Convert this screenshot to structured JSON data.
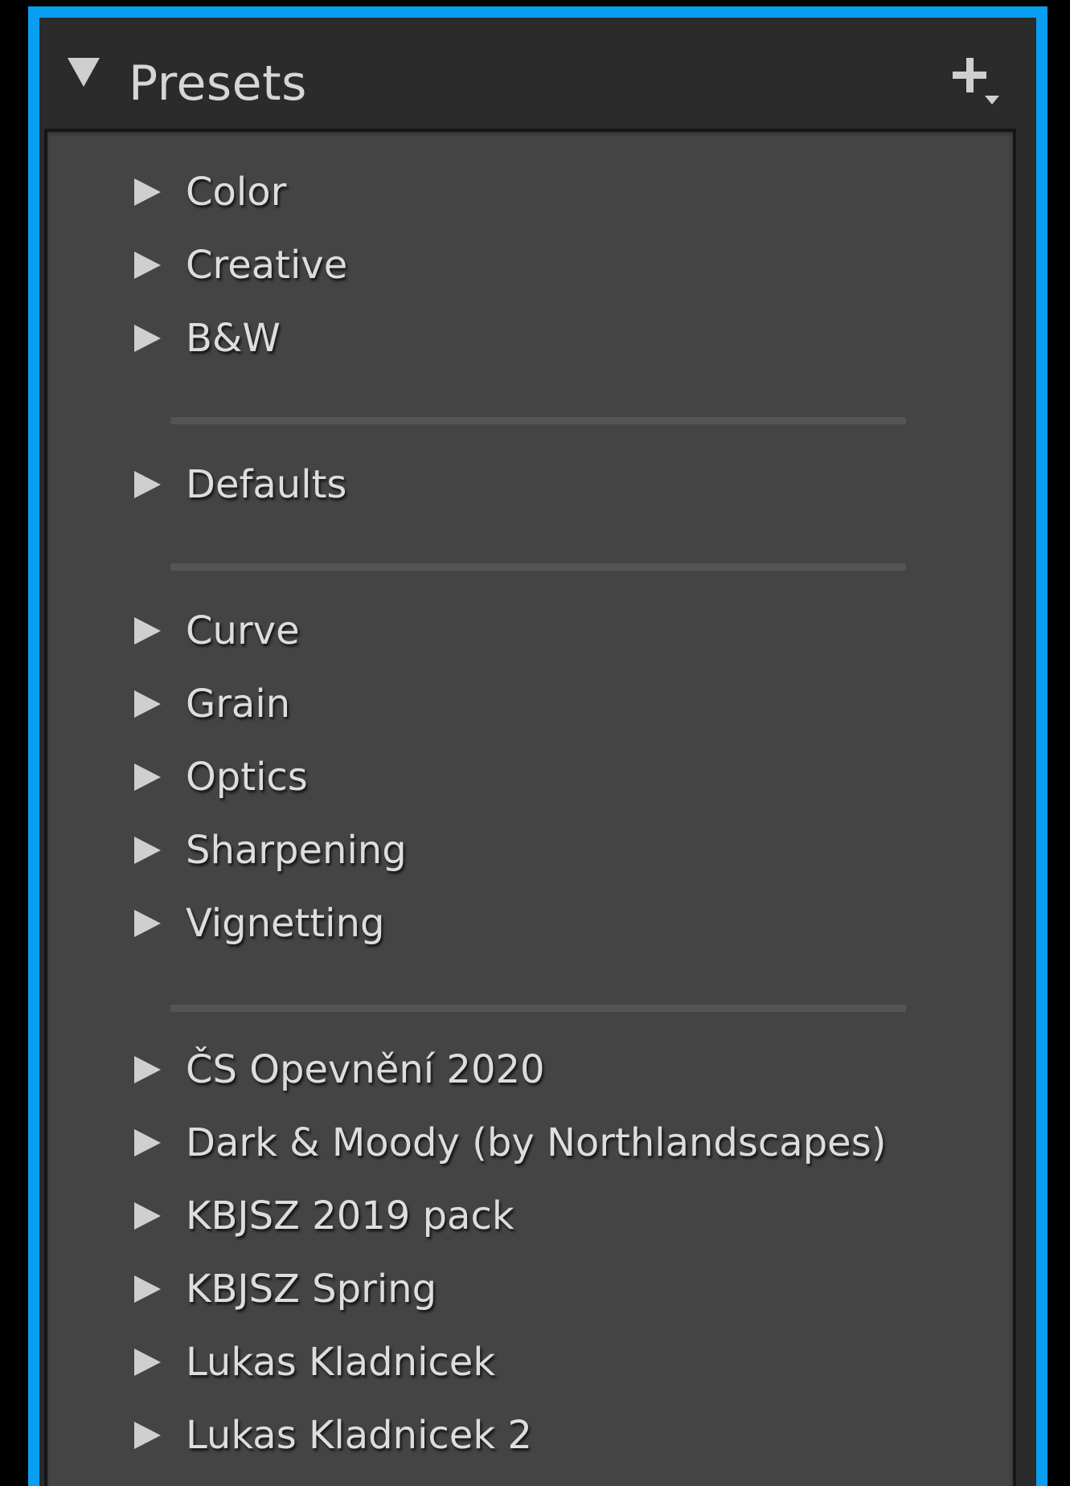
{
  "header": {
    "title": "Presets",
    "collapse_icon": "triangle-down-icon",
    "add_icon": "plus-with-dropdown-icon"
  },
  "groups": [
    {
      "items": [
        {
          "label": "Color"
        },
        {
          "label": "Creative"
        },
        {
          "label": "B&W"
        }
      ]
    },
    {
      "items": [
        {
          "label": "Defaults"
        }
      ]
    },
    {
      "items": [
        {
          "label": "Curve"
        },
        {
          "label": "Grain"
        },
        {
          "label": "Optics"
        },
        {
          "label": "Sharpening"
        },
        {
          "label": "Vignetting"
        }
      ]
    },
    {
      "items": [
        {
          "label": "ČS Opevnění 2020"
        },
        {
          "label": "Dark & Moody (by Northlandscapes)"
        },
        {
          "label": "KBJSZ 2019 pack"
        },
        {
          "label": "KBJSZ Spring"
        },
        {
          "label": "Lukas Kladnicek"
        },
        {
          "label": "Lukas Kladnicek 2"
        }
      ]
    }
  ],
  "colors": {
    "frame_border": "#0a9ef2",
    "panel_bg": "#444444",
    "header_bg": "#2b2b2b",
    "text": "#dddddd"
  }
}
